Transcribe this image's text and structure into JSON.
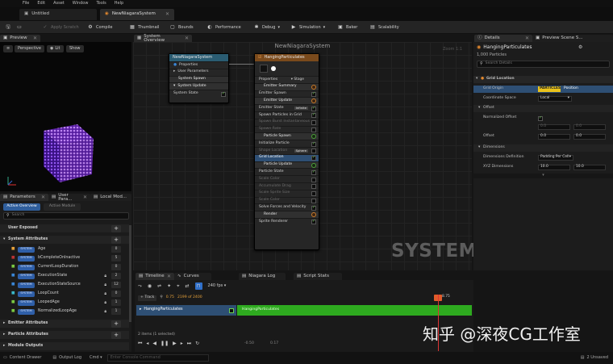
{
  "menu": {
    "items": [
      "File",
      "Edit",
      "Asset",
      "Window",
      "Tools",
      "Help"
    ]
  },
  "tabs": [
    {
      "label": "Untitled"
    },
    {
      "label": "NewNiagaraSystem"
    }
  ],
  "toolbar": {
    "apply_scratch": "Apply Scratch",
    "compile": "Compile",
    "thumbnail": "Thumbnail",
    "bounds": "Bounds",
    "performance": "Performance",
    "debug": "Debug",
    "simulation": "Simulation",
    "baker": "Baker",
    "scalability": "Scalability"
  },
  "preview": {
    "tab": "Preview",
    "perspective": "Perspective",
    "lit": "Lit",
    "show": "Show"
  },
  "graph": {
    "tab": "System Overview",
    "title": "NewNiagaraSystem",
    "zoom": "Zoom 1:1",
    "watermark": "SYSTEM",
    "system_node": {
      "title": "NewNiagaraSystem",
      "rows": [
        "Properties",
        "User Parameters",
        "System Spawn",
        "System Update",
        "System State"
      ]
    },
    "emitter_node": {
      "title": "HangingParticulates",
      "properties": "Properties",
      "stage": "Stage",
      "rows": [
        {
          "label": "Emitter Summary",
          "kind": "section"
        },
        {
          "label": "Emitter Spawn",
          "kind": "plain"
        },
        {
          "label": "Emitter Update",
          "kind": "section"
        },
        {
          "label": "Emitter State",
          "kind": "plain",
          "tag": "Infinite"
        },
        {
          "label": "Spawn Particles in Grid",
          "kind": "plain"
        },
        {
          "label": "Spawn Burst Instantaneous",
          "kind": "faded"
        },
        {
          "label": "Spawn Rate",
          "kind": "faded"
        },
        {
          "label": "Particle Spawn",
          "kind": "section"
        },
        {
          "label": "Initialize Particle",
          "kind": "plain"
        },
        {
          "label": "Shape Location",
          "kind": "faded",
          "tag": "Sphere"
        },
        {
          "label": "Grid Location",
          "kind": "sel"
        },
        {
          "label": "Particle Update",
          "kind": "section"
        },
        {
          "label": "Particle State",
          "kind": "plain"
        },
        {
          "label": "Scale Color",
          "kind": "faded"
        },
        {
          "label": "Accumulate Drag",
          "kind": "faded"
        },
        {
          "label": "Scale Sprite Size",
          "kind": "faded"
        },
        {
          "label": "Scale Color",
          "kind": "faded"
        },
        {
          "label": "Solve Forces and Velocity",
          "kind": "plain"
        },
        {
          "label": "Render",
          "kind": "section"
        },
        {
          "label": "Sprite Renderer",
          "kind": "plain"
        }
      ]
    }
  },
  "details": {
    "tab": "Details",
    "tab2": "Preview Scene S...",
    "object": "HangingParticulates",
    "count": "1,000 Particles",
    "search_placeholder": "Search Details",
    "section_grid": "Grid Location",
    "rows": [
      {
        "label": "Grid Origin",
        "value": "PARTICLES",
        "value2": "Position"
      },
      {
        "label": "Coordinate Space",
        "value": "Local"
      },
      {
        "label": "Offset",
        "section": true
      },
      {
        "label": "Normalized Offset"
      },
      {
        "label": "",
        "value": "0.0",
        "value2": "0.0"
      },
      {
        "label": "Offset",
        "value": "0.0",
        "value2": "0.0"
      },
      {
        "label": "Dimensions",
        "section": true
      },
      {
        "label": "Dimensions Definition",
        "value": "Padding Per Cell"
      },
      {
        "label": "XYZ Dimensions",
        "value": "10.0",
        "value2": "10.0"
      }
    ]
  },
  "params": {
    "tabs": [
      "Parameters",
      "User Para...",
      "Local Mod..."
    ],
    "subtabs": [
      "Active Overview",
      "Active Module"
    ],
    "search_placeholder": "Search",
    "user_exposed": "User Exposed",
    "system_attributes": "System Attributes",
    "badge": "SYSTEM",
    "items": [
      {
        "name": "Age",
        "num": "0"
      },
      {
        "name": "bCompleteOnInactive",
        "num": "5"
      },
      {
        "name": "CurrentLoopDuration",
        "num": "0"
      },
      {
        "name": "ExecutionState",
        "num": "2"
      },
      {
        "name": "ExecutionStateSource",
        "num": "12"
      },
      {
        "name": "LoopCount",
        "num": "0"
      },
      {
        "name": "LoopedAge",
        "num": "1"
      },
      {
        "name": "NormalizedLoopAge",
        "num": "1"
      }
    ],
    "emitter_attributes": "Emitter Attributes",
    "particle_attributes": "Particle Attributes",
    "module_outputs": "Module Outputs"
  },
  "timeline": {
    "tabs": [
      "Timeline",
      "Curves",
      "Niagara Log",
      "Script Stats"
    ],
    "fps": "240 fps",
    "track_button": "Track",
    "time_a": "0.75",
    "time_b": "2199 of 2400",
    "track_label": "HangingParticulates",
    "bar_label": "HangingParticulates",
    "ph_time": "8.75",
    "items_selected": "2 items (1 selected)",
    "start": "-0.50",
    "end": "0.17"
  },
  "statusbar": {
    "drawer": "Content Drawer",
    "output": "Output Log",
    "cmd": "Cmd",
    "placeholder": "Enter Console Command",
    "unsaved": "2 Unsaved"
  },
  "watermark": "知乎 @深夜CG工作室"
}
